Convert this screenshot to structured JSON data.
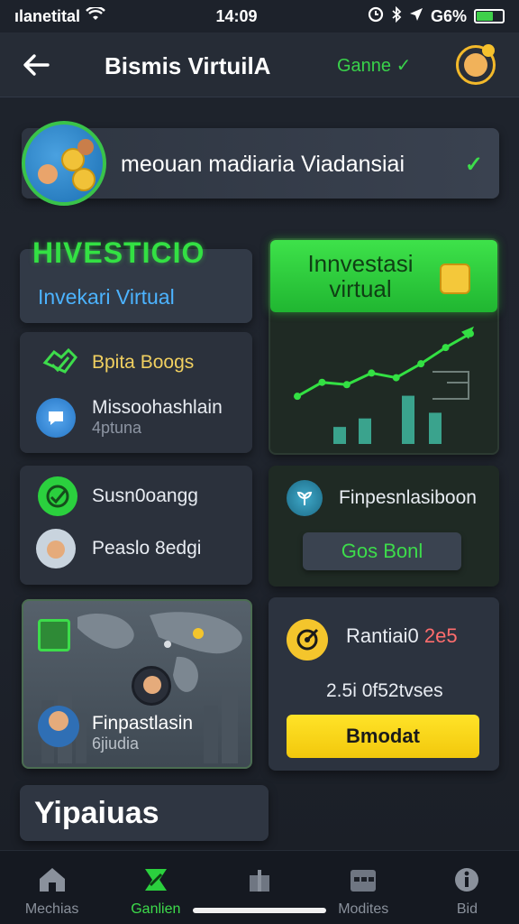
{
  "status_bar": {
    "carrier": "ılanetital",
    "time": "14:09",
    "battery": "G6%",
    "battery_level": 0.66
  },
  "header": {
    "title": "Bismis VirtuilA",
    "game_label": "Ganne",
    "game_check": "✓"
  },
  "profile": {
    "text": "meouan maḋiaria Viadansiai",
    "check": "✓"
  },
  "invest": {
    "heading": "HIVESTICIO",
    "virtual_label": "Invekari Virtual"
  },
  "chart_card": {
    "title_line1": "Innvestasi",
    "title_line2": "virtual",
    "accent": "#33e043"
  },
  "chart_data": {
    "type": "line",
    "series": [
      {
        "values": [
          1,
          2.2,
          2.0,
          3.0,
          2.6,
          3.8,
          5.2,
          6.4
        ]
      }
    ],
    "bars": [
      1.2,
      1.8,
      3.4,
      2.2
    ]
  },
  "list_left": {
    "item1": {
      "label": "Bpita Boogs"
    },
    "item2": {
      "label": "Missoohashlain",
      "sublabel": "4ptuna"
    },
    "item3": {
      "label": "Susn0oangg"
    },
    "item4": {
      "label": "Peaslo 8edgi"
    },
    "item5": {
      "label": "Finpastlasin",
      "sublabel": "6jiudia"
    }
  },
  "right_mid": {
    "label": "Finpesnlasiboon",
    "button": "Gos Bonl"
  },
  "rank": {
    "label": "Rantiai0",
    "value": "2e5",
    "stat": "2.5i 0f52tvses",
    "button": "Bmodat"
  },
  "section": {
    "title": "Yipaiuas"
  },
  "nav": [
    {
      "label": "Mechias",
      "icon": "home-icon"
    },
    {
      "label": "Ganlien",
      "icon": "game-icon"
    },
    {
      "label": "",
      "icon": "gift-icon"
    },
    {
      "label": "Modites",
      "icon": "calendar-icon"
    },
    {
      "label": "Bid",
      "icon": "info-icon"
    }
  ],
  "colors": {
    "accent_green": "#3ddc4b",
    "accent_yellow": "#f4c52c",
    "accent_blue": "#4cb3ff",
    "rank_red": "#ff6d6d"
  }
}
